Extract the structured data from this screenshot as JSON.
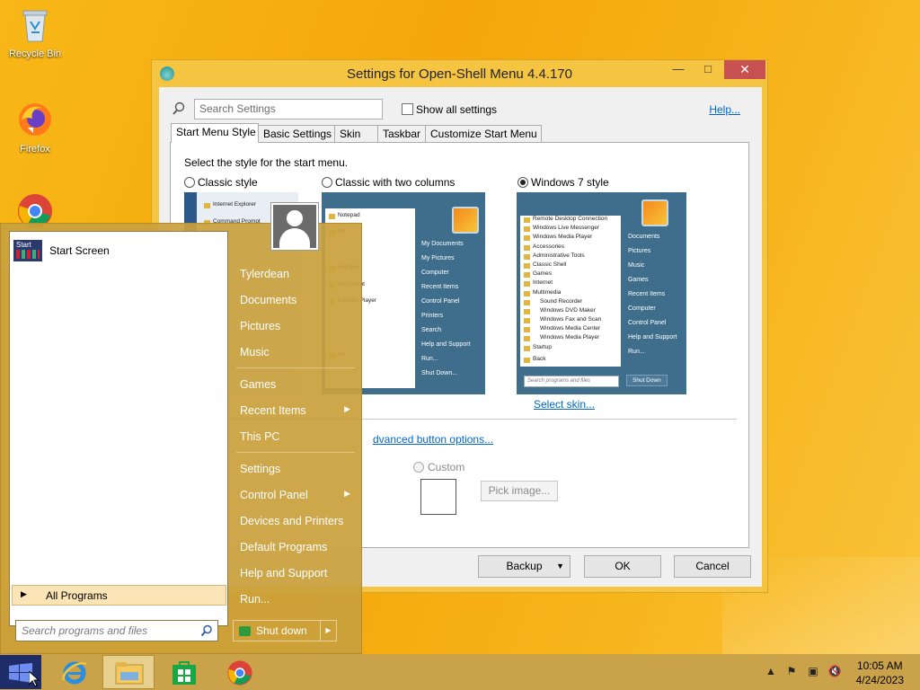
{
  "desktop": {
    "icons": [
      {
        "label": "Recycle Bin",
        "icon": "recycle-bin-icon"
      },
      {
        "label": "Firefox",
        "icon": "firefox-icon"
      },
      {
        "label": "",
        "icon": "chrome-icon"
      }
    ]
  },
  "window": {
    "title": "Settings for Open-Shell Menu 4.4.170",
    "min_glyph": "—",
    "max_glyph": "□",
    "close_glyph": "✕",
    "search_placeholder": "Search Settings",
    "show_all_label": "Show all settings",
    "help_label": "Help...",
    "tabs": [
      "Start Menu Style",
      "Basic Settings",
      "Skin",
      "Taskbar",
      "Customize Start Menu"
    ],
    "active_tab": "Start Menu Style",
    "intro": "Select the style for the start menu.",
    "styles": [
      {
        "label": "Classic style",
        "selected": false
      },
      {
        "label": "Classic with two columns",
        "selected": false
      },
      {
        "label": "Windows 7 style",
        "selected": true
      }
    ],
    "classic_preview": [
      "Internet Explorer",
      "Command Prompt"
    ],
    "two_col_preview": {
      "left": [
        "Notepad",
        "for",
        "Explorer",
        "nd Prompt",
        "s Media Player",
        "ms"
      ],
      "right": [
        "My Documents",
        "My Pictures",
        "Computer",
        "Recent Items",
        "Control Panel",
        "Printers",
        "Search",
        "Help and Support",
        "Run...",
        "Shut Down..."
      ]
    },
    "win7_preview": {
      "left": [
        "Remote Desktop Connection",
        "Windows Live Messenger",
        "Windows Media Player",
        "Accessories",
        "Administrative Tools",
        "Classic Shell",
        "Games",
        "Internet",
        "Multimedia",
        "Sound Recorder",
        "Windows DVD Maker",
        "Windows Fax and Scan",
        "Windows Media Center",
        "Windows Media Player",
        "Startup"
      ],
      "back": "Back",
      "search": "Search programs and files",
      "right": [
        "Documents",
        "Pictures",
        "Music",
        "Games",
        "Recent Items",
        "Computer",
        "Control Panel",
        "Help and Support",
        "Run..."
      ],
      "shutdown": "Shut Down"
    },
    "select_skin": "Select skin...",
    "advanced_link": "dvanced button options...",
    "custom_label": "Custom",
    "pick_image": "Pick image...",
    "buttons": {
      "backup": "Backup",
      "ok": "OK",
      "cancel": "Cancel"
    }
  },
  "start_menu": {
    "pinned": [
      {
        "label": "Start Screen",
        "tile_text": "Start"
      }
    ],
    "all_programs": "All Programs",
    "search_placeholder": "Search programs and files",
    "right_items": [
      {
        "label": "Tylerdean",
        "sub": false
      },
      {
        "label": "Documents",
        "sub": false
      },
      {
        "label": "Pictures",
        "sub": false
      },
      {
        "label": "Music",
        "sub": false
      },
      {
        "label": "Games",
        "sub": false
      },
      {
        "label": "Recent Items",
        "sub": true
      },
      {
        "label": "This PC",
        "sub": false
      },
      {
        "label": "Settings",
        "sub": false
      },
      {
        "label": "Control Panel",
        "sub": true
      },
      {
        "label": "Devices and Printers",
        "sub": false
      },
      {
        "label": "Default Programs",
        "sub": false
      },
      {
        "label": "Help and Support",
        "sub": false
      },
      {
        "label": "Run...",
        "sub": false
      }
    ],
    "shutdown": "Shut down"
  },
  "taskbar": {
    "apps": [
      "start-button",
      "internet-explorer-icon",
      "file-explorer-icon",
      "store-icon",
      "chrome-icon"
    ],
    "time": "10:05 AM",
    "date": "4/24/2023"
  },
  "colors": {
    "accent": "#c9a24a",
    "window_frame": "#f5c542",
    "close": "#c75050",
    "link": "#0066cc"
  }
}
